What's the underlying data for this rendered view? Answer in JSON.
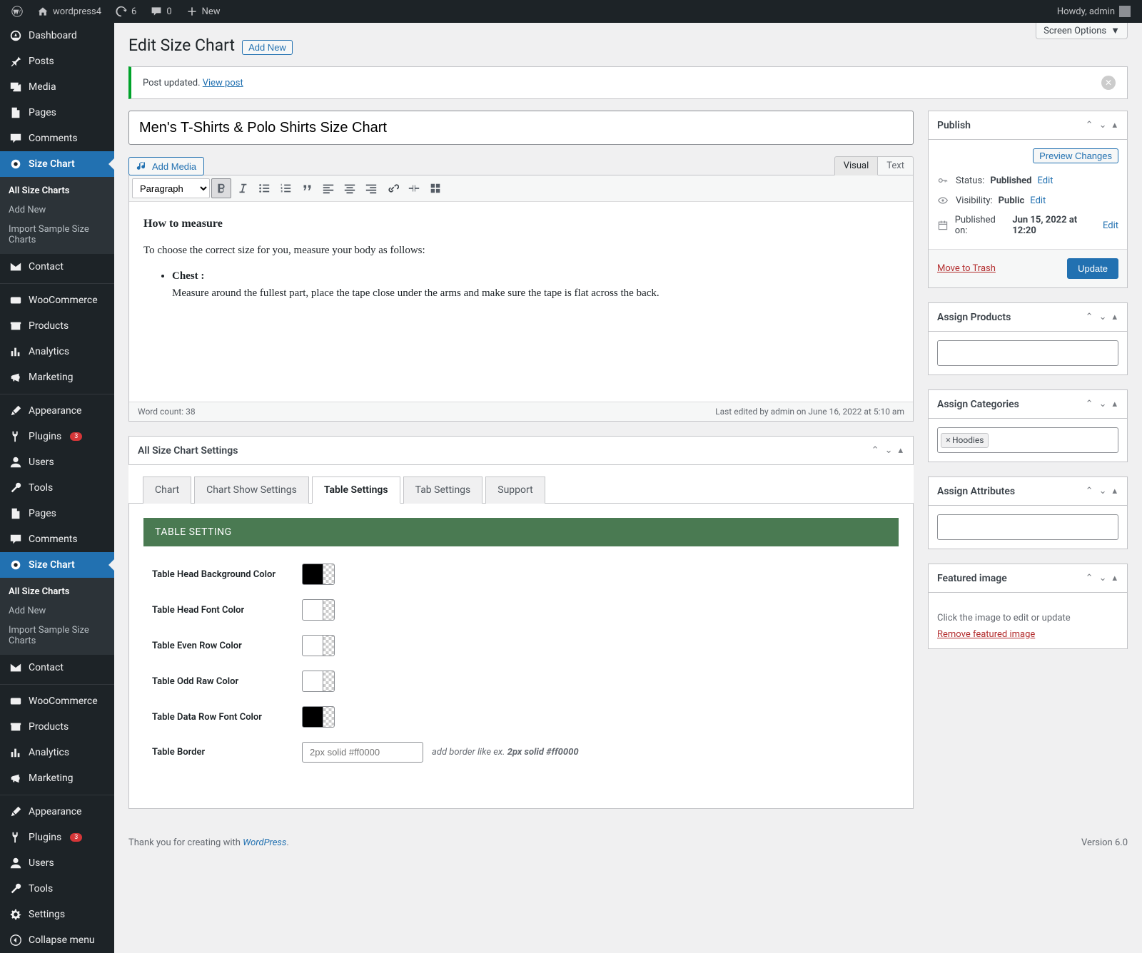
{
  "topbar": {
    "site_name": "wordpress4",
    "updates_count": "6",
    "comments_count": "0",
    "new_label": "New",
    "howdy": "Howdy, admin"
  },
  "screen_options_label": "Screen Options",
  "page_title": "Edit Size Chart",
  "add_new_button": "Add New",
  "notice": {
    "message": "Post updated.",
    "link_text": "View post"
  },
  "sidebar_menu": [
    {
      "label": "Dashboard",
      "icon": "dashboard"
    },
    {
      "label": "Posts",
      "icon": "pin"
    },
    {
      "label": "Media",
      "icon": "media"
    },
    {
      "label": "Pages",
      "icon": "page"
    },
    {
      "label": "Comments",
      "icon": "comment"
    },
    {
      "label": "Size Chart",
      "icon": "circle",
      "current": true,
      "submenu": [
        "All Size Charts",
        "Add New",
        "Import Sample Size Charts"
      ]
    },
    {
      "label": "Contact",
      "icon": "mail"
    },
    {
      "sep": true
    },
    {
      "label": "WooCommerce",
      "icon": "woo"
    },
    {
      "label": "Products",
      "icon": "archive"
    },
    {
      "label": "Analytics",
      "icon": "chart"
    },
    {
      "label": "Marketing",
      "icon": "megaphone"
    },
    {
      "sep": true
    },
    {
      "label": "Appearance",
      "icon": "brush"
    },
    {
      "label": "Plugins",
      "icon": "plug",
      "badge": "3"
    },
    {
      "label": "Users",
      "icon": "user"
    },
    {
      "label": "Tools",
      "icon": "tool"
    },
    {
      "label": "Pages",
      "icon": "page"
    },
    {
      "label": "Comments",
      "icon": "comment"
    },
    {
      "label": "Size Chart",
      "icon": "circle",
      "current": true,
      "submenu": [
        "All Size Charts",
        "Add New",
        "Import Sample Size Charts"
      ]
    },
    {
      "label": "Contact",
      "icon": "mail"
    },
    {
      "sep": true
    },
    {
      "label": "WooCommerce",
      "icon": "woo"
    },
    {
      "label": "Products",
      "icon": "archive"
    },
    {
      "label": "Analytics",
      "icon": "chart"
    },
    {
      "label": "Marketing",
      "icon": "megaphone"
    },
    {
      "sep": true
    },
    {
      "label": "Appearance",
      "icon": "brush"
    },
    {
      "label": "Plugins",
      "icon": "plug",
      "badge": "3"
    },
    {
      "label": "Users",
      "icon": "user"
    },
    {
      "label": "Tools",
      "icon": "tool"
    },
    {
      "label": "Settings",
      "icon": "gear"
    },
    {
      "label": "Collapse menu",
      "icon": "collapse"
    }
  ],
  "sidebar_submenu_current": "All Size Charts",
  "post": {
    "title_value": "Men's T-Shirts & Polo Shirts Size Chart",
    "add_media_label": "Add Media",
    "format_select": "Paragraph",
    "tab_visual": "Visual",
    "tab_text": "Text",
    "body_heading": "How to measure",
    "body_paragraph": "To choose the correct size for you, measure your body as follows:",
    "body_bullet_label": "Chest :",
    "body_bullet_text": "Measure around the fullest part, place the tape close under the arms and make sure the tape is flat across the back.",
    "word_count_label": "Word count: 38",
    "last_edited": "Last edited by admin on June 16, 2022 at 5:10 am"
  },
  "settings_box": {
    "title": "All Size Chart Settings",
    "tabs": [
      "Chart",
      "Chart Show Settings",
      "Table Settings",
      "Tab Settings",
      "Support"
    ],
    "active_tab": "Table Settings",
    "panel_header": "TABLE SETTING",
    "rows": [
      {
        "label": "Table Head Background Color",
        "type": "color",
        "value": "#000000"
      },
      {
        "label": "Table Head Font Color",
        "type": "color",
        "value": "#ffffff"
      },
      {
        "label": "Table Even Row Color",
        "type": "color",
        "value": "#ffffff"
      },
      {
        "label": "Table Odd Raw Color",
        "type": "color",
        "value": "#ffffff"
      },
      {
        "label": "Table Data Row Font Color",
        "type": "color",
        "value": "#000000"
      },
      {
        "label": "Table Border",
        "type": "text",
        "placeholder": "2px solid #ff0000",
        "hint_prefix": "add border like ex. ",
        "hint_em": "2px solid #ff0000"
      }
    ]
  },
  "publish": {
    "title": "Publish",
    "preview_label": "Preview Changes",
    "status_label": "Status:",
    "status_value": "Published",
    "visibility_label": "Visibility:",
    "visibility_value": "Public",
    "published_on_label": "Published on:",
    "published_on_value": "Jun 15, 2022 at 12:20",
    "edit_link": "Edit",
    "trash_label": "Move to Trash",
    "update_label": "Update"
  },
  "side_boxes": {
    "assign_products": "Assign Products",
    "assign_categories": "Assign Categories",
    "category_token": "Hoodies",
    "assign_attributes": "Assign Attributes",
    "featured_image": "Featured image",
    "featured_hint": "Click the image to edit or update",
    "remove_image": "Remove featured image"
  },
  "footer": {
    "thanks_prefix": "Thank you for creating with ",
    "thanks_link": "WordPress",
    "version": "Version 6.0"
  }
}
